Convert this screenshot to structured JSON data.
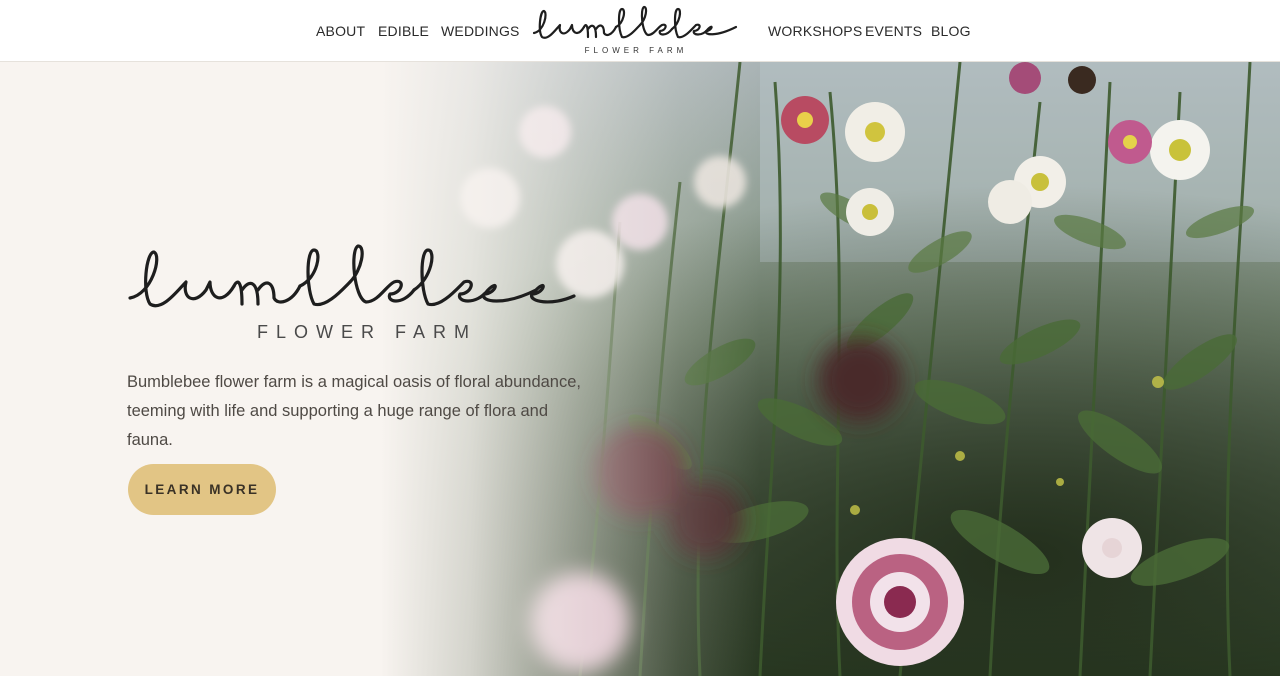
{
  "nav": {
    "left_items": [
      "ABOUT",
      "EDIBLE",
      "WEDDINGS"
    ],
    "right_items": [
      "WORKSHOPS",
      "EVENTS",
      "BLOG"
    ],
    "logo_script": "bumblebee",
    "logo_sub": "FLOWER FARM"
  },
  "hero": {
    "logo_script": "bumblebee",
    "logo_sub": "FLOWER FARM",
    "tagline_line1": "Bumblebee flower farm is a magical oasis of floral abundance,",
    "tagline_line2": "teeming with life and supporting a huge range of flora and fauna.",
    "cta_label": "LEARN MORE"
  },
  "colors": {
    "page_bg": "#f8f4f0",
    "cta_bg": "#e2c585",
    "text": "#4f4a45",
    "foliage": "#3f5a34"
  }
}
